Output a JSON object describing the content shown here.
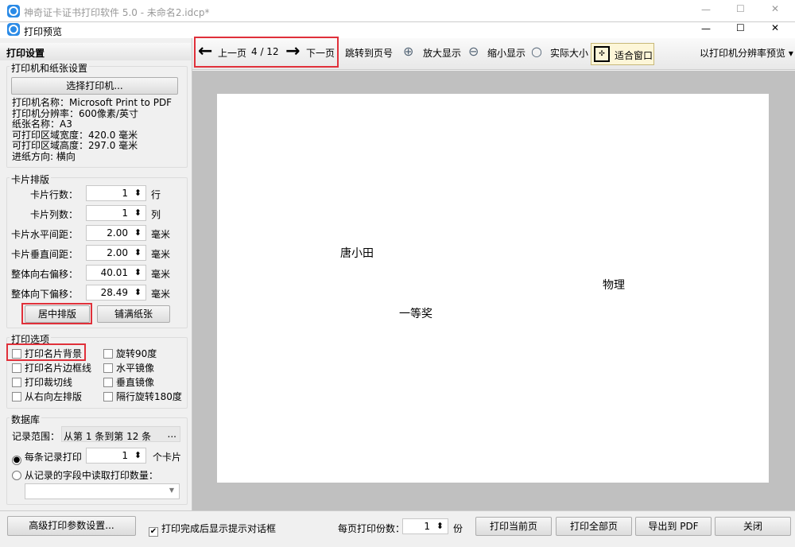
{
  "outer_title": "神奇证卡证书打印软件 5.0 - 未命名2.idcp*",
  "dialog_title": "打印预览",
  "window_controls": {
    "minimize": "—",
    "maximize": "☐",
    "close": "✕"
  },
  "toolbar": {
    "prev": "上一页",
    "page": "4 / 12",
    "next": "下一页",
    "goto": "跳转到页号",
    "zoom_in": "放大显示",
    "zoom_out": "缩小显示",
    "actual": "实际大小",
    "fit": "适合窗口",
    "resolution": "以打印机分辨率预览"
  },
  "left": {
    "header": "打印设置",
    "printer_group": "打印机和纸张设置",
    "select_printer": "选择打印机...",
    "info": [
      "打印机名称：Microsoft Print to PDF",
      "打印机分辨率：600像素/英寸",
      "纸张名称：A3",
      "可打印区域宽度：420.0 毫米",
      "可打印区域高度：297.0 毫米",
      "进纸方向: 横向"
    ],
    "layout_group": "卡片排版",
    "layout_rows": [
      {
        "label": "卡片行数：",
        "value": "1",
        "unit": "行"
      },
      {
        "label": "卡片列数：",
        "value": "1",
        "unit": "列"
      },
      {
        "label": "卡片水平间距：",
        "value": "2.00",
        "unit": "毫米"
      },
      {
        "label": "卡片垂直间距：",
        "value": "2.00",
        "unit": "毫米"
      },
      {
        "label": "整体向右偏移：",
        "value": "40.01",
        "unit": "毫米"
      },
      {
        "label": "整体向下偏移：",
        "value": "28.49",
        "unit": "毫米"
      }
    ],
    "center_btn": "居中排版",
    "fill_btn": "铺满纸张",
    "options_group": "打印选项",
    "options_left": [
      "打印名片背景",
      "打印名片边框线",
      "打印裁切线",
      "从右向左排版"
    ],
    "options_right": [
      "旋转90度",
      "水平镜像",
      "垂直镜像",
      "隔行旋转180度"
    ],
    "db_group": "数据库",
    "range_label": "记录范围：",
    "range_value": "从第 1 条到第 12 条",
    "range_btn": "...",
    "radio1": "每条记录打印",
    "radio1_value": "1",
    "radio1_unit": "个卡片",
    "radio2": "从记录的字段中读取打印数量："
  },
  "preview": {
    "texts": [
      "唐小田",
      "物理",
      "一等奖"
    ]
  },
  "bottom": {
    "advanced": "高级打印参数设置...",
    "show_dialog": "打印完成后显示提示对话框",
    "copies_label": "每页打印份数：",
    "copies": "1",
    "copies_unit": "份",
    "print_current": "打印当前页",
    "print_all": "打印全部页",
    "export_pdf": "导出到 PDF",
    "close": "关闭"
  }
}
